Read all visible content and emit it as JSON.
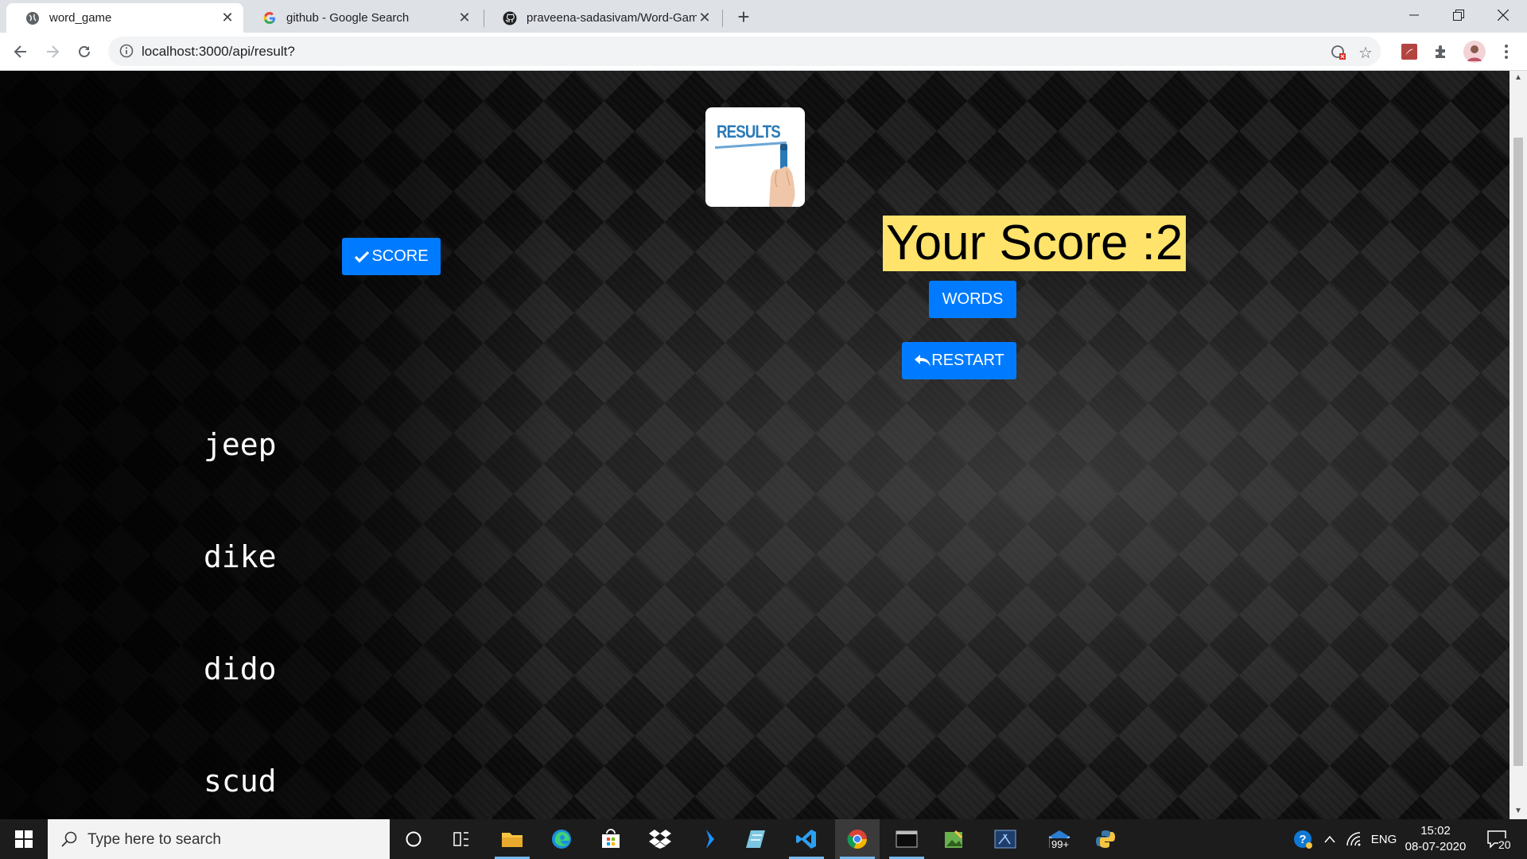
{
  "browser": {
    "tabs": [
      {
        "title": "word_game",
        "active": true
      },
      {
        "title": "github - Google Search",
        "active": false
      },
      {
        "title": "praveena-sadasivam/Word-Game",
        "active": false
      }
    ],
    "url": "localhost:3000/api/result?"
  },
  "page": {
    "results_image_text": "RESULTS",
    "score_button": "SCORE",
    "score_heading": "Your Score :2",
    "words_button": "WORDS",
    "restart_button": "RESTART",
    "words": [
      "jeep",
      "dike",
      "dido",
      "scud"
    ]
  },
  "taskbar": {
    "search_placeholder": "Type here to search",
    "mail_badge": "99+",
    "language": "ENG",
    "time": "15:02",
    "date": "08-07-2020",
    "notification_count": "20"
  },
  "colors": {
    "button_blue": "#007bff",
    "score_highlight": "#ffe36b"
  }
}
